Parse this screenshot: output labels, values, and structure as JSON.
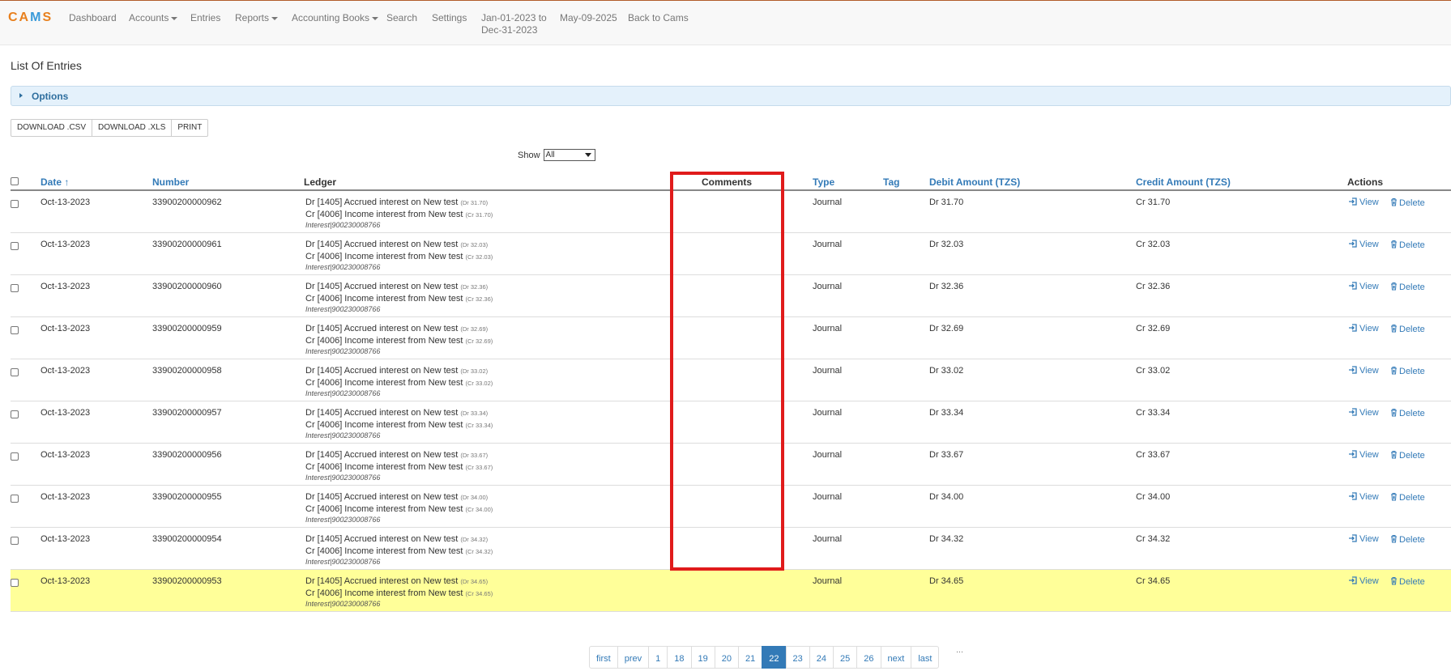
{
  "brand": {
    "logo_pre": "CA",
    "logo_mid": "M",
    "logo_post": "S"
  },
  "nav": {
    "dashboard": "Dashboard",
    "accounts": "Accounts",
    "entries": "Entries",
    "reports": "Reports",
    "accounting_books": "Accounting Books",
    "search": "Search",
    "settings": "Settings",
    "period_line1": "Jan-01-2023 to",
    "period_line2": "Dec-31-2023",
    "today": "May-09-2025",
    "back": "Back to Cams"
  },
  "page_title": "List Of Entries",
  "options_label": "Options",
  "buttons": {
    "csv": "DOWNLOAD .CSV",
    "xls": "DOWNLOAD .XLS",
    "print": "PRINT"
  },
  "show": {
    "label": "Show",
    "value": "All"
  },
  "columns": {
    "date": "Date",
    "number": "Number",
    "ledger": "Ledger",
    "comments": "Comments",
    "type": "Type",
    "tag": "Tag",
    "debit": "Debit Amount (TZS)",
    "credit": "Credit Amount (TZS)",
    "actions": "Actions"
  },
  "actions": {
    "view": "View",
    "delete": "Delete"
  },
  "rows": [
    {
      "date": "Oct-13-2023",
      "number": "33900200000962",
      "dr_ledger": "Dr [1405] Accrued interest on New test",
      "dr_small": "(Dr 31.70)",
      "cr_ledger": "Cr [4006] Income interest from New test",
      "cr_small": "(Cr 31.70)",
      "narration": "Interest|900230008766",
      "comments": "",
      "type": "Journal",
      "tag": "",
      "debit": "Dr 31.70",
      "credit": "Cr 31.70"
    },
    {
      "date": "Oct-13-2023",
      "number": "33900200000961",
      "dr_ledger": "Dr [1405] Accrued interest on New test",
      "dr_small": "(Dr 32.03)",
      "cr_ledger": "Cr [4006] Income interest from New test",
      "cr_small": "(Cr 32.03)",
      "narration": "Interest|900230008766",
      "comments": "",
      "type": "Journal",
      "tag": "",
      "debit": "Dr 32.03",
      "credit": "Cr 32.03"
    },
    {
      "date": "Oct-13-2023",
      "number": "33900200000960",
      "dr_ledger": "Dr [1405] Accrued interest on New test",
      "dr_small": "(Dr 32.36)",
      "cr_ledger": "Cr [4006] Income interest from New test",
      "cr_small": "(Cr 32.36)",
      "narration": "Interest|900230008766",
      "comments": "",
      "type": "Journal",
      "tag": "",
      "debit": "Dr 32.36",
      "credit": "Cr 32.36"
    },
    {
      "date": "Oct-13-2023",
      "number": "33900200000959",
      "dr_ledger": "Dr [1405] Accrued interest on New test",
      "dr_small": "(Dr 32.69)",
      "cr_ledger": "Cr [4006] Income interest from New test",
      "cr_small": "(Cr 32.69)",
      "narration": "Interest|900230008766",
      "comments": "",
      "type": "Journal",
      "tag": "",
      "debit": "Dr 32.69",
      "credit": "Cr 32.69"
    },
    {
      "date": "Oct-13-2023",
      "number": "33900200000958",
      "dr_ledger": "Dr [1405] Accrued interest on New test",
      "dr_small": "(Dr 33.02)",
      "cr_ledger": "Cr [4006] Income interest from New test",
      "cr_small": "(Cr 33.02)",
      "narration": "Interest|900230008766",
      "comments": "",
      "type": "Journal",
      "tag": "",
      "debit": "Dr 33.02",
      "credit": "Cr 33.02"
    },
    {
      "date": "Oct-13-2023",
      "number": "33900200000957",
      "dr_ledger": "Dr [1405] Accrued interest on New test",
      "dr_small": "(Dr 33.34)",
      "cr_ledger": "Cr [4006] Income interest from New test",
      "cr_small": "(Cr 33.34)",
      "narration": "Interest|900230008766",
      "comments": "",
      "type": "Journal",
      "tag": "",
      "debit": "Dr 33.34",
      "credit": "Cr 33.34"
    },
    {
      "date": "Oct-13-2023",
      "number": "33900200000956",
      "dr_ledger": "Dr [1405] Accrued interest on New test",
      "dr_small": "(Dr 33.67)",
      "cr_ledger": "Cr [4006] Income interest from New test",
      "cr_small": "(Cr 33.67)",
      "narration": "Interest|900230008766",
      "comments": "",
      "type": "Journal",
      "tag": "",
      "debit": "Dr 33.67",
      "credit": "Cr 33.67"
    },
    {
      "date": "Oct-13-2023",
      "number": "33900200000955",
      "dr_ledger": "Dr [1405] Accrued interest on New test",
      "dr_small": "(Dr 34.00)",
      "cr_ledger": "Cr [4006] Income interest from New test",
      "cr_small": "(Cr 34.00)",
      "narration": "Interest|900230008766",
      "comments": "",
      "type": "Journal",
      "tag": "",
      "debit": "Dr 34.00",
      "credit": "Cr 34.00"
    },
    {
      "date": "Oct-13-2023",
      "number": "33900200000954",
      "dr_ledger": "Dr [1405] Accrued interest on New test",
      "dr_small": "(Dr 34.32)",
      "cr_ledger": "Cr [4006] Income interest from New test",
      "cr_small": "(Cr 34.32)",
      "narration": "Interest|900230008766",
      "comments": "",
      "type": "Journal",
      "tag": "",
      "debit": "Dr 34.32",
      "credit": "Cr 34.32"
    },
    {
      "date": "Oct-13-2023",
      "number": "33900200000953",
      "dr_ledger": "Dr [1405] Accrued interest on New test",
      "dr_small": "(Dr 34.65)",
      "cr_ledger": "Cr [4006] Income interest from New test",
      "cr_small": "(Cr 34.65)",
      "narration": "Interest|900230008766",
      "comments": "",
      "type": "Journal",
      "tag": "",
      "debit": "Dr 34.65",
      "credit": "Cr 34.65",
      "highlighted": true
    }
  ],
  "pagination": [
    "first",
    "prev",
    "1",
    "18",
    "19",
    "20",
    "21",
    "22",
    "23",
    "24",
    "25",
    "26",
    "next",
    "last"
  ],
  "pagination_active": "22",
  "pagination_more": "···",
  "colors": {
    "accent": "#337ab7",
    "highlight_row": "#ffff99",
    "annotation_box": "#e01b1b"
  }
}
